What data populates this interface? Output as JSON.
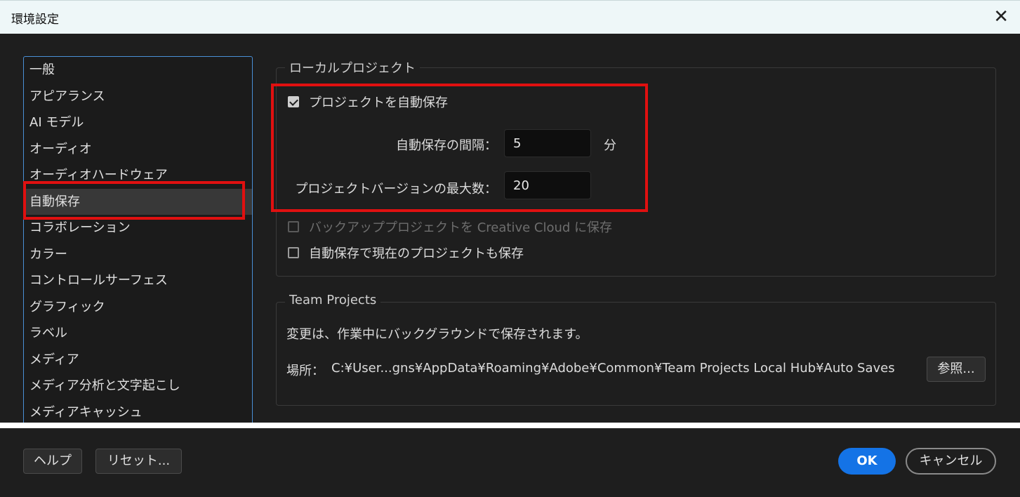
{
  "window": {
    "title": "環境設定",
    "close_glyph": "✕"
  },
  "sidebar": {
    "items": [
      {
        "label": "一般"
      },
      {
        "label": "アピアランス"
      },
      {
        "label": "AI モデル"
      },
      {
        "label": "オーディオ"
      },
      {
        "label": "オーディオハードウェア"
      },
      {
        "label": "自動保存"
      },
      {
        "label": "コラボレーション"
      },
      {
        "label": "カラー"
      },
      {
        "label": "コントロールサーフェス"
      },
      {
        "label": "グラフィック"
      },
      {
        "label": "ラベル"
      },
      {
        "label": "メディア"
      },
      {
        "label": "メディア分析と文字起こし"
      },
      {
        "label": "メディアキャッシュ"
      }
    ],
    "active_label": "自動保存"
  },
  "local": {
    "legend": "ローカルプロジェクト",
    "autosave_label": "プロジェクトを自動保存",
    "autosave_checked": true,
    "interval_label": "自動保存の間隔：",
    "interval_value": "5",
    "interval_unit": "分",
    "maxver_label": "プロジェクトバージョンの最大数：",
    "maxver_value": "20",
    "cc_backup_label": "バックアッププロジェクトを Creative Cloud に保存",
    "cc_backup_checked": false,
    "cc_backup_disabled": true,
    "save_current_label": "自動保存で現在のプロジェクトも保存",
    "save_current_checked": false
  },
  "team": {
    "legend": "Team Projects",
    "note": "変更は、作業中にバックグラウンドで保存されます。",
    "location_label": "場所：",
    "location_path": "C:¥User...gns¥AppData¥Roaming¥Adobe¥Common¥Team Projects Local Hub¥Auto Saves",
    "browse_label": "参照..."
  },
  "footer": {
    "help_label": "ヘルプ",
    "reset_label": "リセット...",
    "ok_label": "OK",
    "cancel_label": "キャンセル"
  },
  "colors": {
    "accent": "#1473e6",
    "highlight_box": "#e01010",
    "list_border": "#4a8fd6"
  }
}
